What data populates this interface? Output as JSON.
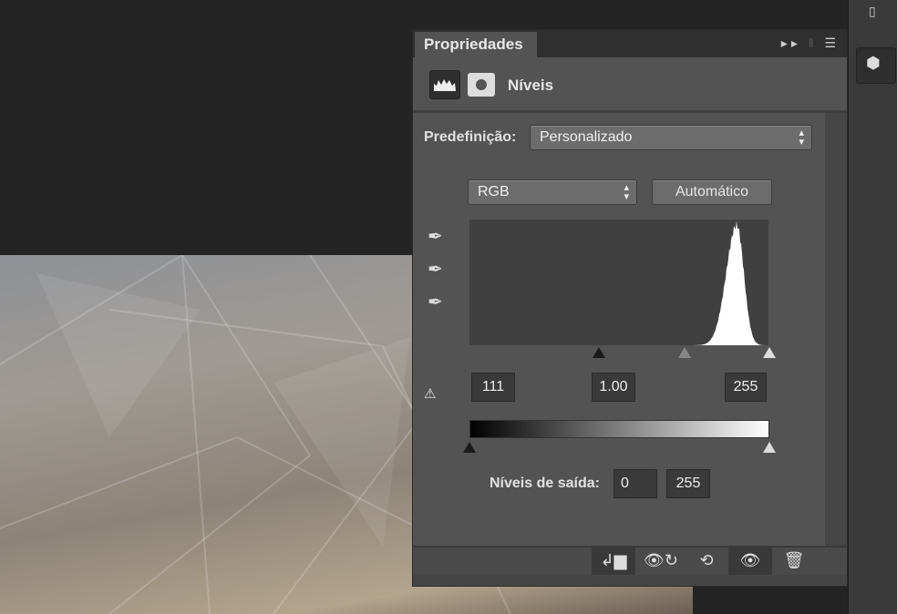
{
  "panel": {
    "tab_label": "Propriedades",
    "title": "Níveis",
    "preset_label": "Predefinição:",
    "preset_value": "Personalizado",
    "channel_value": "RGB",
    "auto_button": "Automático",
    "input_black": "111",
    "input_gamma": "1.00",
    "input_white": "255",
    "output_label": "Níveis de saída:",
    "output_black": "0",
    "output_white": "255"
  },
  "histogram": {
    "levels_range": [
      0,
      255
    ],
    "peak_level": 228
  }
}
